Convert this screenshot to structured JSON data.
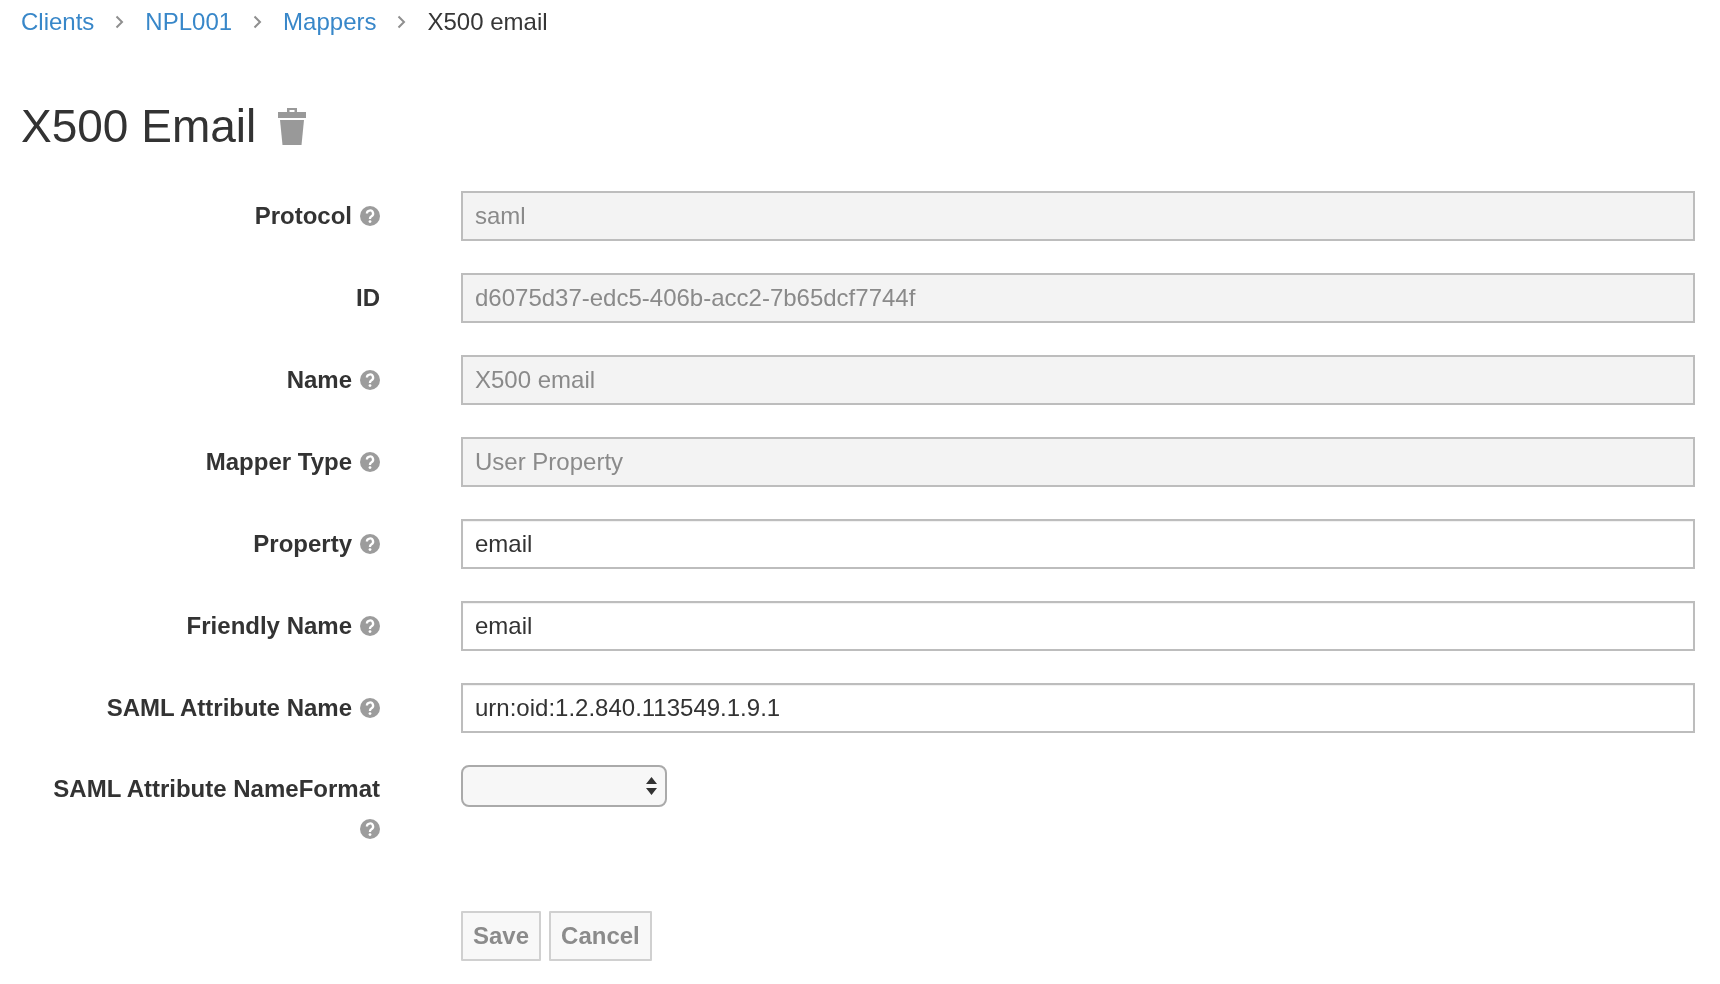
{
  "breadcrumb": [
    {
      "label": "Clients",
      "kind": "link"
    },
    {
      "label": "NPL001",
      "kind": "link"
    },
    {
      "label": "Mappers",
      "kind": "link"
    },
    {
      "label": "X500 email",
      "kind": "current"
    }
  ],
  "page_title": "X500 Email",
  "form": {
    "fields": [
      {
        "label": "Protocol",
        "help": true,
        "kind": "text",
        "value": "saml",
        "readonly": true
      },
      {
        "label": "ID",
        "help": false,
        "kind": "text",
        "value": "d6075d37-edc5-406b-acc2-7b65dcf7744f",
        "readonly": true
      },
      {
        "label": "Name",
        "help": true,
        "kind": "text",
        "value": "X500 email",
        "readonly": true
      },
      {
        "label": "Mapper Type",
        "help": true,
        "kind": "text",
        "value": "User Property",
        "readonly": true
      },
      {
        "label": "Property",
        "help": true,
        "kind": "text",
        "value": "email",
        "readonly": false
      },
      {
        "label": "Friendly Name",
        "help": true,
        "kind": "text",
        "value": "email",
        "readonly": false
      },
      {
        "label": "SAML Attribute Name",
        "help": true,
        "kind": "text",
        "value": "urn:oid:1.2.840.113549.1.9.1",
        "readonly": false
      },
      {
        "label": "SAML Attribute NameFormat",
        "help": true,
        "kind": "select"
      }
    ]
  },
  "buttons": [
    {
      "label": "Save",
      "disabled": true
    },
    {
      "label": "Cancel",
      "disabled": true
    }
  ]
}
